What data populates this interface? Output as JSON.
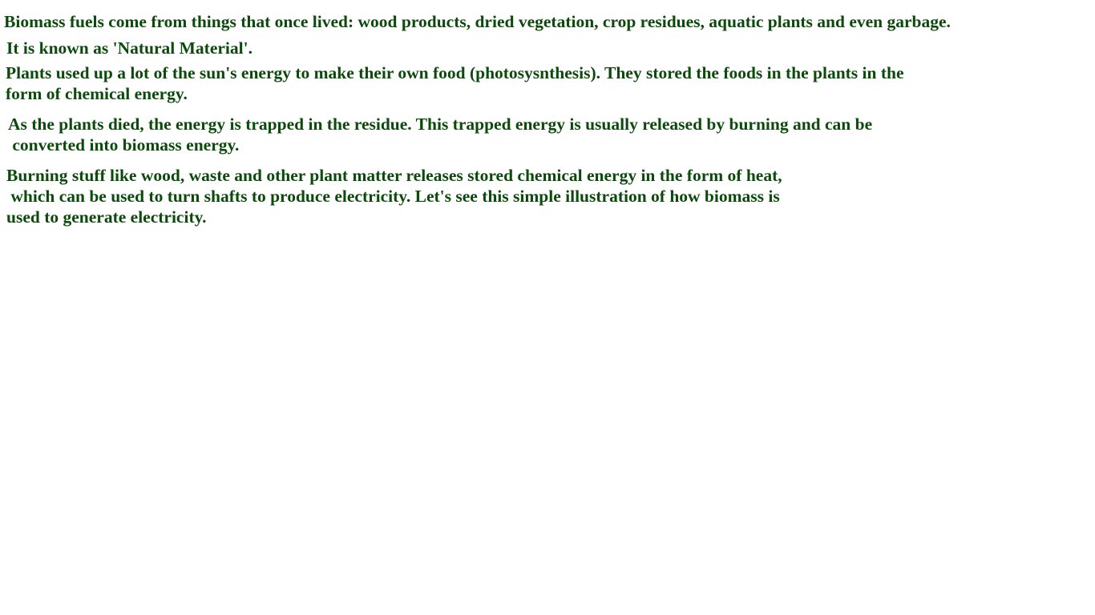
{
  "document": {
    "lines": [
      "Biomass fuels come from things that once lived: wood products, dried vegetation, crop residues, aquatic plants and even garbage.",
      "It is known as 'Natural Material'.",
      "Plants used up a lot of the sun's energy to make their own food (photosysnthesis). They stored the foods in the plants in the",
      "form of chemical energy.",
      "As the plants died, the energy is trapped in the residue. This trapped energy is usually released by burning and can be",
      " converted into biomass energy.",
      "Burning stuff like wood, waste and other plant matter releases stored chemical energy in the form of heat,",
      " which can be used to turn shafts to produce electricity. Let's see this simple illustration of how biomass is",
      "used to generate electricity."
    ]
  },
  "colors": {
    "text": "#0b4a0b",
    "background": "#ffffff"
  }
}
